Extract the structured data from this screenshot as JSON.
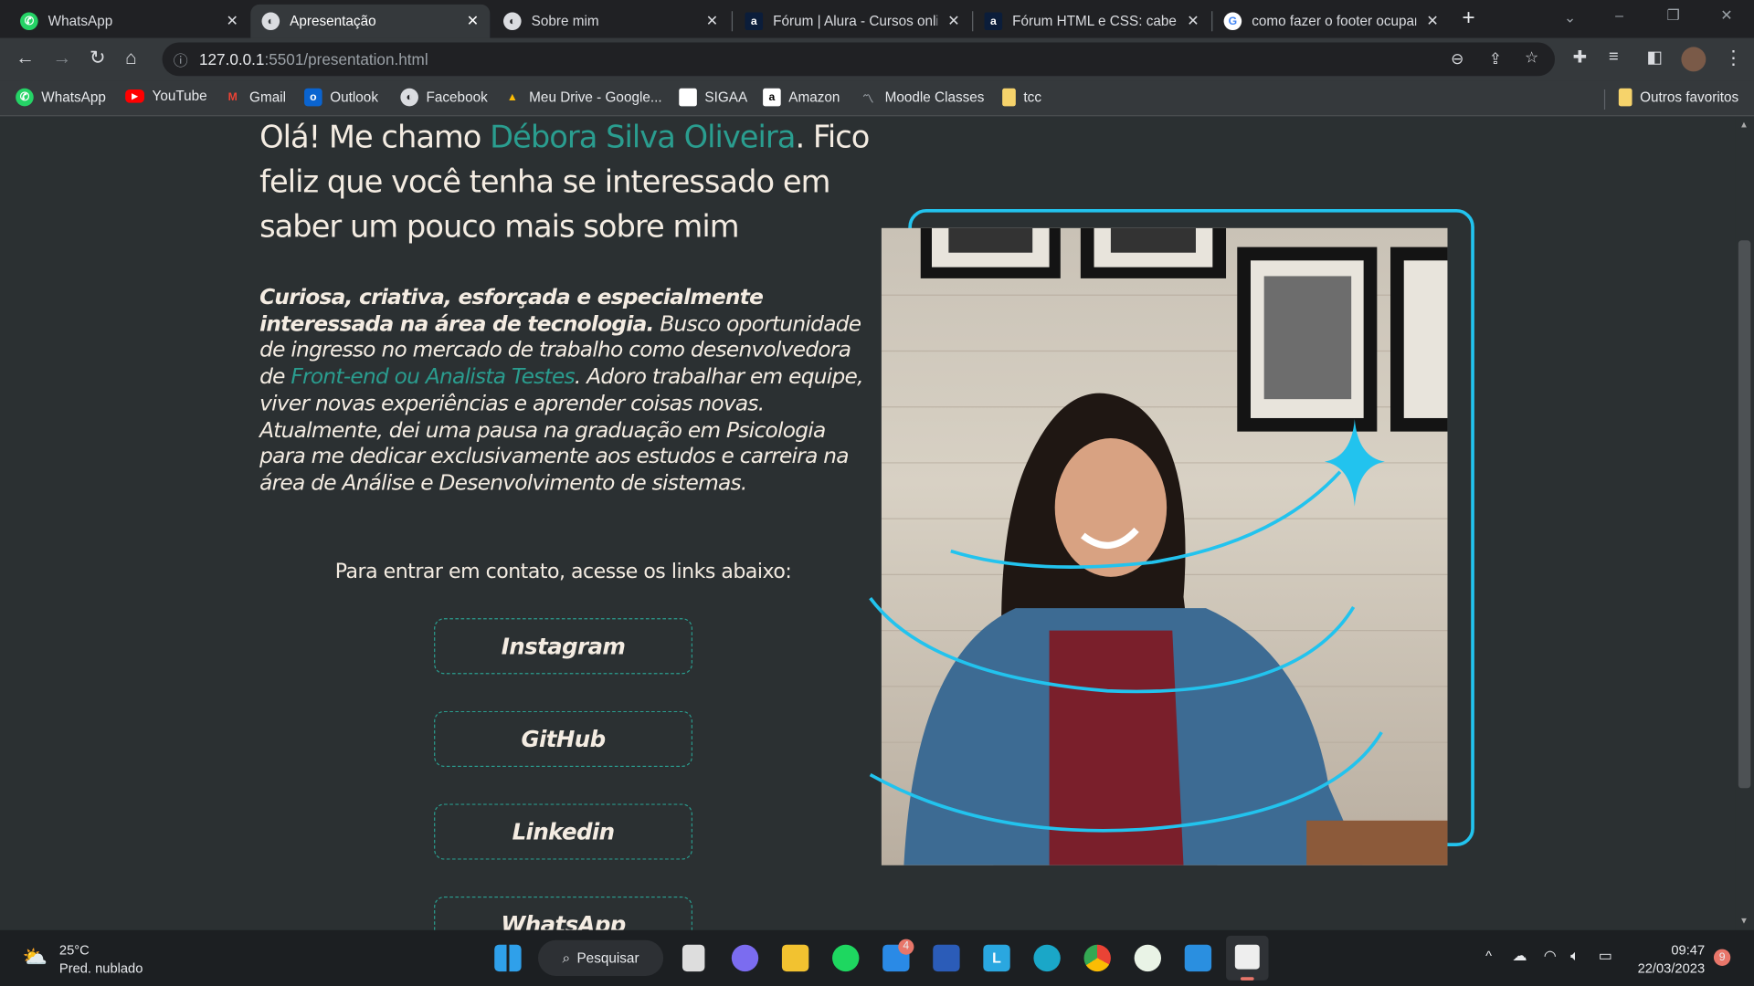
{
  "browser": {
    "tabs": [
      {
        "title": "WhatsApp",
        "icon": "whatsapp-icon",
        "active": false
      },
      {
        "title": "Apresentação",
        "icon": "globe-icon",
        "active": true
      },
      {
        "title": "Sobre mim",
        "icon": "globe-icon",
        "active": false
      },
      {
        "title": "Fórum | Alura - Cursos online",
        "icon": "alura-icon",
        "active": false
      },
      {
        "title": "Fórum HTML e CSS: cabeçalho",
        "icon": "alura-icon",
        "active": false
      },
      {
        "title": "como fazer o footer ocupar",
        "icon": "google-icon",
        "active": false
      }
    ],
    "url_host": "127.0.0.1",
    "url_path": ":5501/presentation.html",
    "bookmarks": [
      "WhatsApp",
      "YouTube",
      "Gmail",
      "Outlook",
      "Facebook",
      "Meu Drive - Google...",
      "SIGAA",
      "Amazon",
      "Moodle Classes",
      "tcc"
    ],
    "other_bookmarks": "Outros favoritos"
  },
  "page": {
    "heading_pre": "Olá! Me chamo ",
    "heading_name": "Débora Silva Oliveira",
    "heading_post": ". Fico feliz que você tenha se interessado em saber um pouco mais sobre mim",
    "bio_bold": "Curiosa, criativa, esforçada e especialmente interessada na área de tecnologia.",
    "bio_1": " Busco oportunidade de ingresso no mercado de trabalho como desenvolvedora de ",
    "bio_highlight": "Front-end ou Analista Testes",
    "bio_2": ". Adoro trabalhar em equipe, viver novas experiências e aprender coisas novas. Atualmente, dei uma pausa na graduação em Psicologia para me dedicar exclusivamente aos estudos e carreira na área de Análise e Desenvolvimento de sistemas.",
    "contact_text": "Para entrar em contato, acesse os links abaixo:",
    "links": [
      "Instagram",
      "GitHub",
      "Linkedin",
      "WhatsApp"
    ],
    "accent": "#2a9d8f",
    "frame_color": "#22c3ee"
  },
  "taskbar": {
    "weather_temp": "25°C",
    "weather_desc": "Pred. nublado",
    "search": "Pesquisar",
    "mail_badge": "4",
    "time": "09:47",
    "date": "22/03/2023",
    "notif_count": "9"
  }
}
